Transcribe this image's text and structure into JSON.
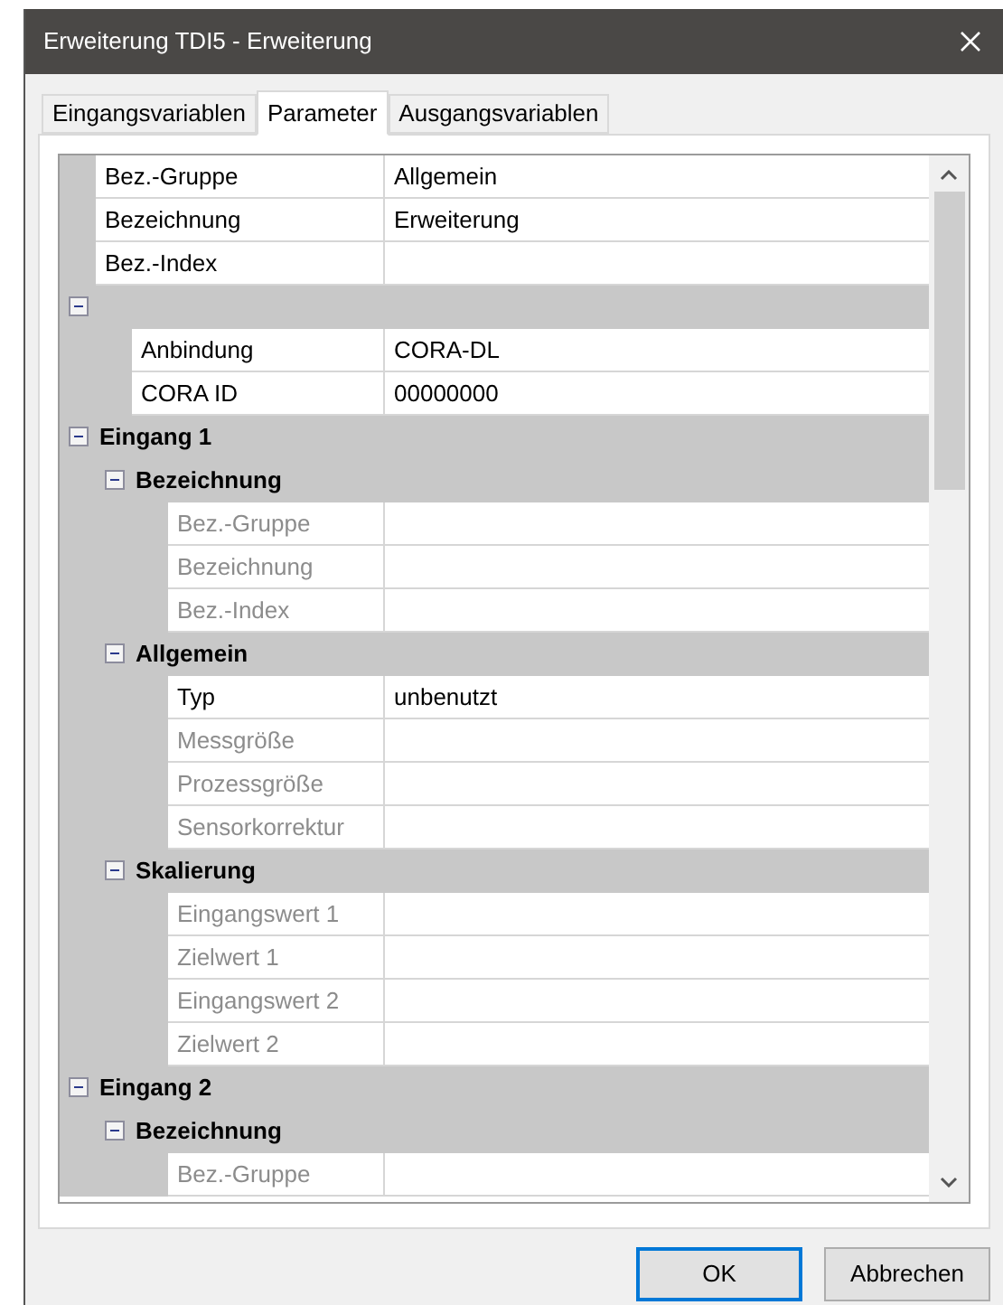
{
  "window": {
    "title": "Erweiterung TDI5 - Erweiterung"
  },
  "tabs": [
    {
      "label": "Eingangsvariablen",
      "selected": false
    },
    {
      "label": "Parameter",
      "selected": true
    },
    {
      "label": "Ausgangsvariablen",
      "selected": false
    }
  ],
  "property_grid": {
    "items": [
      {
        "kind": "property",
        "label": "Bez.-Gruppe",
        "value": "Allgemein",
        "disabled": false
      },
      {
        "kind": "property",
        "label": "Bezeichnung",
        "value": "Erweiterung",
        "disabled": false
      },
      {
        "kind": "property",
        "label": "Bez.-Index",
        "disabled": false
      },
      {
        "kind": "category",
        "expanded": true,
        "children": [
          {
            "kind": "property",
            "label": "Anbindung",
            "value": "CORA-DL",
            "disabled": false
          },
          {
            "kind": "property",
            "label": "CORA ID",
            "value": "00000000",
            "disabled": false
          }
        ]
      },
      {
        "kind": "category",
        "label": "Eingang 1",
        "expanded": true,
        "children": [
          {
            "kind": "category",
            "label": "Bezeichnung",
            "expanded": true,
            "children": [
              {
                "kind": "property",
                "label": "Bez.-Gruppe",
                "disabled": true
              },
              {
                "kind": "property",
                "label": "Bezeichnung",
                "disabled": true
              },
              {
                "kind": "property",
                "label": "Bez.-Index",
                "disabled": true
              }
            ]
          },
          {
            "kind": "category",
            "label": "Allgemein",
            "expanded": true,
            "children": [
              {
                "kind": "property",
                "label": "Typ",
                "value": "unbenutzt",
                "disabled": false
              },
              {
                "kind": "property",
                "label": "Messgröße",
                "disabled": true
              },
              {
                "kind": "property",
                "label": "Prozessgröße",
                "disabled": true
              },
              {
                "kind": "property",
                "label": "Sensorkorrektur",
                "disabled": true
              }
            ]
          },
          {
            "kind": "category",
            "label": "Skalierung",
            "expanded": true,
            "children": [
              {
                "kind": "property",
                "label": "Eingangswert 1",
                "disabled": true
              },
              {
                "kind": "property",
                "label": "Zielwert 1",
                "disabled": true
              },
              {
                "kind": "property",
                "label": "Eingangswert 2",
                "disabled": true
              },
              {
                "kind": "property",
                "label": "Zielwert 2",
                "disabled": true
              }
            ]
          }
        ]
      },
      {
        "kind": "category",
        "label": "Eingang 2",
        "expanded": true,
        "children": [
          {
            "kind": "category",
            "label": "Bezeichnung",
            "expanded": true,
            "children": [
              {
                "kind": "property",
                "label": "Bez.-Gruppe",
                "disabled": true
              }
            ]
          }
        ]
      }
    ]
  },
  "buttons": [
    {
      "label": "OK",
      "default": true
    },
    {
      "label": "Abbrechen",
      "default": false
    }
  ]
}
